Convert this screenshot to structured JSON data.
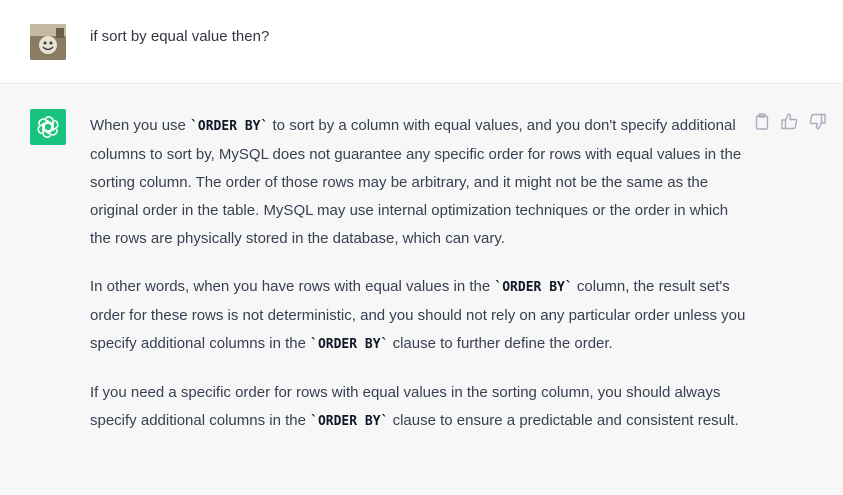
{
  "user_message": {
    "text": "if sort by equal value then?"
  },
  "assistant_message": {
    "p1": {
      "t1": "When you use ",
      "c1": "`ORDER BY`",
      "t2": " to sort by a column with equal values, and you don't specify additional columns to sort by, MySQL does not guarantee any specific order for rows with equal values in the sorting column. The order of those rows may be arbitrary, and it might not be the same as the original order in the table. MySQL may use internal optimization techniques or the order in which the rows are physically stored in the database, which can vary."
    },
    "p2": {
      "t1": "In other words, when you have rows with equal values in the ",
      "c1": "`ORDER BY`",
      "t2": " column, the result set's order for these rows is not deterministic, and you should not rely on any particular order unless you specify additional columns in the ",
      "c2": "`ORDER BY`",
      "t3": " clause to further define the order."
    },
    "p3": {
      "t1": "If you need a specific order for rows with equal values in the sorting column, you should always specify additional columns in the ",
      "c1": "`ORDER BY`",
      "t2": " clause to ensure a predictable and consistent result."
    }
  },
  "actions": {
    "icons": [
      "clipboard-icon",
      "thumbs-up-icon",
      "thumbs-down-icon"
    ]
  },
  "colors": {
    "assistant_avatar_bg": "#19c37d",
    "assistant_row_bg": "#f7f7f8",
    "text": "#374151",
    "icon": "#acacbe"
  }
}
